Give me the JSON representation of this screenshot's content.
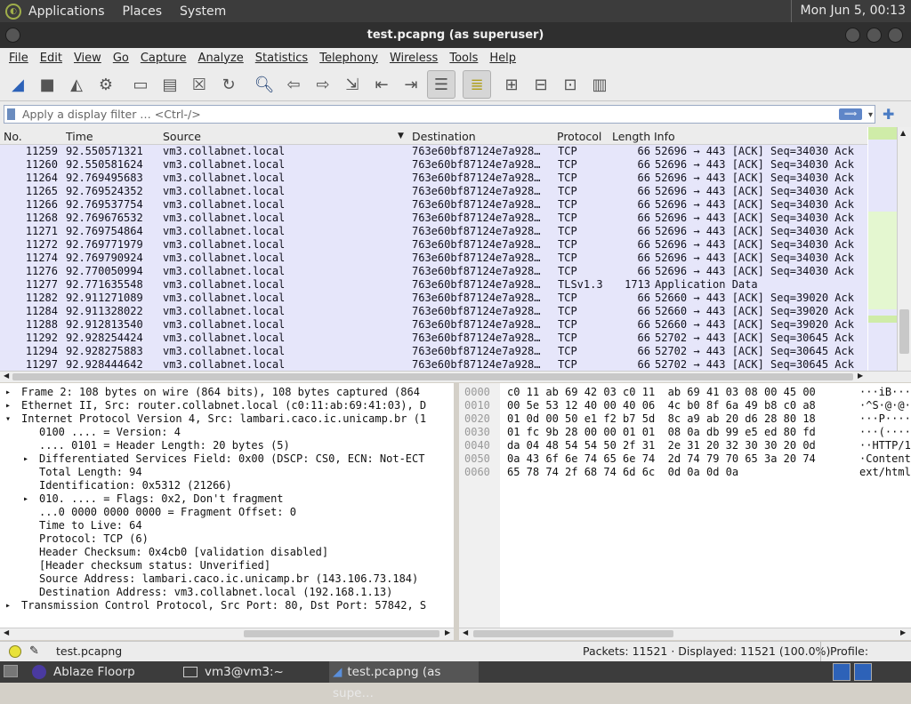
{
  "topbar": {
    "menus": [
      "Applications",
      "Places",
      "System"
    ],
    "clock": "Mon Jun  5, 00:13"
  },
  "window": {
    "title": "test.pcapng (as superuser)"
  },
  "menu": [
    "File",
    "Edit",
    "View",
    "Go",
    "Capture",
    "Analyze",
    "Statistics",
    "Telephony",
    "Wireless",
    "Tools",
    "Help"
  ],
  "toolbar": {
    "icons": [
      "shark-fin-icon",
      "stop-icon",
      "restart-icon",
      "options-gear-icon",
      "open-folder-icon",
      "save-file-icon",
      "close-file-icon",
      "reload-icon",
      "search-icon",
      "back-icon",
      "forward-icon",
      "goto-icon",
      "first-icon",
      "last-icon",
      "autoscroll-icon",
      "colorize-icon",
      "zoom-in-icon",
      "zoom-out-icon",
      "normal-size-icon",
      "resize-columns-icon"
    ]
  },
  "filter": {
    "placeholder": "Apply a display filter … <Ctrl-/>",
    "apply_arrow": "⟹"
  },
  "packet_list": {
    "columns": [
      "No.",
      "Time",
      "Source",
      "Destination",
      "Protocol",
      "Length",
      "Info"
    ],
    "rows": [
      [
        "11259",
        "92.550571321",
        "vm3.collabnet.local",
        "763e60bf87124e7a928…",
        "TCP",
        "66",
        "52696 → 443 [ACK] Seq=34030 Ack"
      ],
      [
        "11260",
        "92.550581624",
        "vm3.collabnet.local",
        "763e60bf87124e7a928…",
        "TCP",
        "66",
        "52696 → 443 [ACK] Seq=34030 Ack"
      ],
      [
        "11264",
        "92.769495683",
        "vm3.collabnet.local",
        "763e60bf87124e7a928…",
        "TCP",
        "66",
        "52696 → 443 [ACK] Seq=34030 Ack"
      ],
      [
        "11265",
        "92.769524352",
        "vm3.collabnet.local",
        "763e60bf87124e7a928…",
        "TCP",
        "66",
        "52696 → 443 [ACK] Seq=34030 Ack"
      ],
      [
        "11266",
        "92.769537754",
        "vm3.collabnet.local",
        "763e60bf87124e7a928…",
        "TCP",
        "66",
        "52696 → 443 [ACK] Seq=34030 Ack"
      ],
      [
        "11268",
        "92.769676532",
        "vm3.collabnet.local",
        "763e60bf87124e7a928…",
        "TCP",
        "66",
        "52696 → 443 [ACK] Seq=34030 Ack"
      ],
      [
        "11271",
        "92.769754864",
        "vm3.collabnet.local",
        "763e60bf87124e7a928…",
        "TCP",
        "66",
        "52696 → 443 [ACK] Seq=34030 Ack"
      ],
      [
        "11272",
        "92.769771979",
        "vm3.collabnet.local",
        "763e60bf87124e7a928…",
        "TCP",
        "66",
        "52696 → 443 [ACK] Seq=34030 Ack"
      ],
      [
        "11274",
        "92.769790924",
        "vm3.collabnet.local",
        "763e60bf87124e7a928…",
        "TCP",
        "66",
        "52696 → 443 [ACK] Seq=34030 Ack"
      ],
      [
        "11276",
        "92.770050994",
        "vm3.collabnet.local",
        "763e60bf87124e7a928…",
        "TCP",
        "66",
        "52696 → 443 [ACK] Seq=34030 Ack"
      ],
      [
        "11277",
        "92.771635548",
        "vm3.collabnet.local",
        "763e60bf87124e7a928…",
        "TLSv1.3",
        "1713",
        "Application Data"
      ],
      [
        "11282",
        "92.911271089",
        "vm3.collabnet.local",
        "763e60bf87124e7a928…",
        "TCP",
        "66",
        "52660 → 443 [ACK] Seq=39020 Ack"
      ],
      [
        "11284",
        "92.911328022",
        "vm3.collabnet.local",
        "763e60bf87124e7a928…",
        "TCP",
        "66",
        "52660 → 443 [ACK] Seq=39020 Ack"
      ],
      [
        "11288",
        "92.912813540",
        "vm3.collabnet.local",
        "763e60bf87124e7a928…",
        "TCP",
        "66",
        "52660 → 443 [ACK] Seq=39020 Ack"
      ],
      [
        "11292",
        "92.928254424",
        "vm3.collabnet.local",
        "763e60bf87124e7a928…",
        "TCP",
        "66",
        "52702 → 443 [ACK] Seq=30645 Ack"
      ],
      [
        "11294",
        "92.928275883",
        "vm3.collabnet.local",
        "763e60bf87124e7a928…",
        "TCP",
        "66",
        "52702 → 443 [ACK] Seq=30645 Ack"
      ],
      [
        "11297",
        "92.928444642",
        "vm3.collabnet.local",
        "763e60bf87124e7a928…",
        "TCP",
        "66",
        "52702 → 443 [ACK] Seq=30645 Ack"
      ]
    ]
  },
  "details": [
    {
      "t": "Frame 2: 108 bytes on wire (864 bits), 108 bytes captured (864",
      "e": "▸",
      "i": 0
    },
    {
      "t": "Ethernet II, Src: router.collabnet.local (c0:11:ab:69:41:03), D",
      "e": "▸",
      "i": 0
    },
    {
      "t": "Internet Protocol Version 4, Src: lambari.caco.ic.unicamp.br (1",
      "e": "▾",
      "i": 0
    },
    {
      "t": "0100 .... = Version: 4",
      "e": "",
      "i": 1
    },
    {
      "t": ".... 0101 = Header Length: 20 bytes (5)",
      "e": "",
      "i": 1
    },
    {
      "t": "Differentiated Services Field: 0x00 (DSCP: CS0, ECN: Not-ECT",
      "e": "▸",
      "i": 1
    },
    {
      "t": "Total Length: 94",
      "e": "",
      "i": 1
    },
    {
      "t": "Identification: 0x5312 (21266)",
      "e": "",
      "i": 1
    },
    {
      "t": "010. .... = Flags: 0x2, Don't fragment",
      "e": "▸",
      "i": 1
    },
    {
      "t": "...0 0000 0000 0000 = Fragment Offset: 0",
      "e": "",
      "i": 1
    },
    {
      "t": "Time to Live: 64",
      "e": "",
      "i": 1
    },
    {
      "t": "Protocol: TCP (6)",
      "e": "",
      "i": 1
    },
    {
      "t": "Header Checksum: 0x4cb0 [validation disabled]",
      "e": "",
      "i": 1
    },
    {
      "t": "[Header checksum status: Unverified]",
      "e": "",
      "i": 1
    },
    {
      "t": "Source Address: lambari.caco.ic.unicamp.br (143.106.73.184)",
      "e": "",
      "i": 1
    },
    {
      "t": "Destination Address: vm3.collabnet.local (192.168.1.13)",
      "e": "",
      "i": 1
    },
    {
      "t": "Transmission Control Protocol, Src Port: 80, Dst Port: 57842, S",
      "e": "▸",
      "i": 0
    }
  ],
  "bytes": [
    {
      "off": "0000",
      "hex": "c0 11 ab 69 42 03 c0 11  ab 69 41 03 08 00 45 00",
      "asc": "···iB···"
    },
    {
      "off": "0010",
      "hex": "00 5e 53 12 40 00 40 06  4c b0 8f 6a 49 b8 c0 a8",
      "asc": "·^S·@·@·"
    },
    {
      "off": "0020",
      "hex": "01 0d 00 50 e1 f2 b7 5d  8c a9 ab 20 d6 28 80 18",
      "asc": "···P····"
    },
    {
      "off": "0030",
      "hex": "01 fc 9b 28 00 00 01 01  08 0a db 99 e5 ed 80 fd",
      "asc": "···(····"
    },
    {
      "off": "0040",
      "hex": "da 04 48 54 54 50 2f 31  2e 31 20 32 30 30 20 0d",
      "asc": "··HTTP/1"
    },
    {
      "off": "0050",
      "hex": "0a 43 6f 6e 74 65 6e 74  2d 74 79 70 65 3a 20 74",
      "asc": "·Content"
    },
    {
      "off": "0060",
      "hex": "65 78 74 2f 68 74 6d 6c  0d 0a 0d 0a",
      "asc": "ext/html"
    }
  ],
  "status": {
    "file": "test.pcapng",
    "packets": "Packets: 11521 · Displayed: 11521 (100.0%)",
    "profile": "Profile: Default"
  },
  "taskbar": {
    "tasks": [
      "Ablaze Floorp",
      "vm3@vm3:~",
      "test.pcapng (as supe…"
    ]
  }
}
